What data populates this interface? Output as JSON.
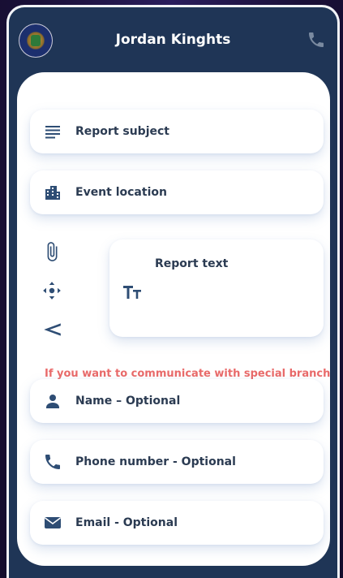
{
  "header": {
    "title": "Jordan Kinghts",
    "logo": "police-emblem-logo",
    "call_icon": "phone-icon"
  },
  "colors": {
    "background": "#1a1038",
    "header": "#1f3556",
    "sheet": "#ffffff",
    "icon": "#2e4d74",
    "label": "#2b3b52",
    "notice": "#e96a6a",
    "header_call_icon": "#7a8aa0"
  },
  "form": {
    "report_subject": {
      "label": "Report subject",
      "icon": "notes-icon"
    },
    "event_location": {
      "label": "Event location",
      "icon": "buildings-icon"
    },
    "report_text": {
      "label": "Report text",
      "icon": "text-size-icon"
    },
    "side_actions": [
      {
        "icon": "attachment-icon"
      },
      {
        "icon": "move-location-icon"
      },
      {
        "icon": "send-icon"
      }
    ],
    "notice": "If you want to communicate with special branch",
    "name": {
      "label": "Name – Optional",
      "icon": "person-icon"
    },
    "phone": {
      "label": "Phone number - Optional",
      "icon": "phone-icon"
    },
    "email": {
      "label": "Email - Optional",
      "icon": "mail-icon"
    }
  }
}
